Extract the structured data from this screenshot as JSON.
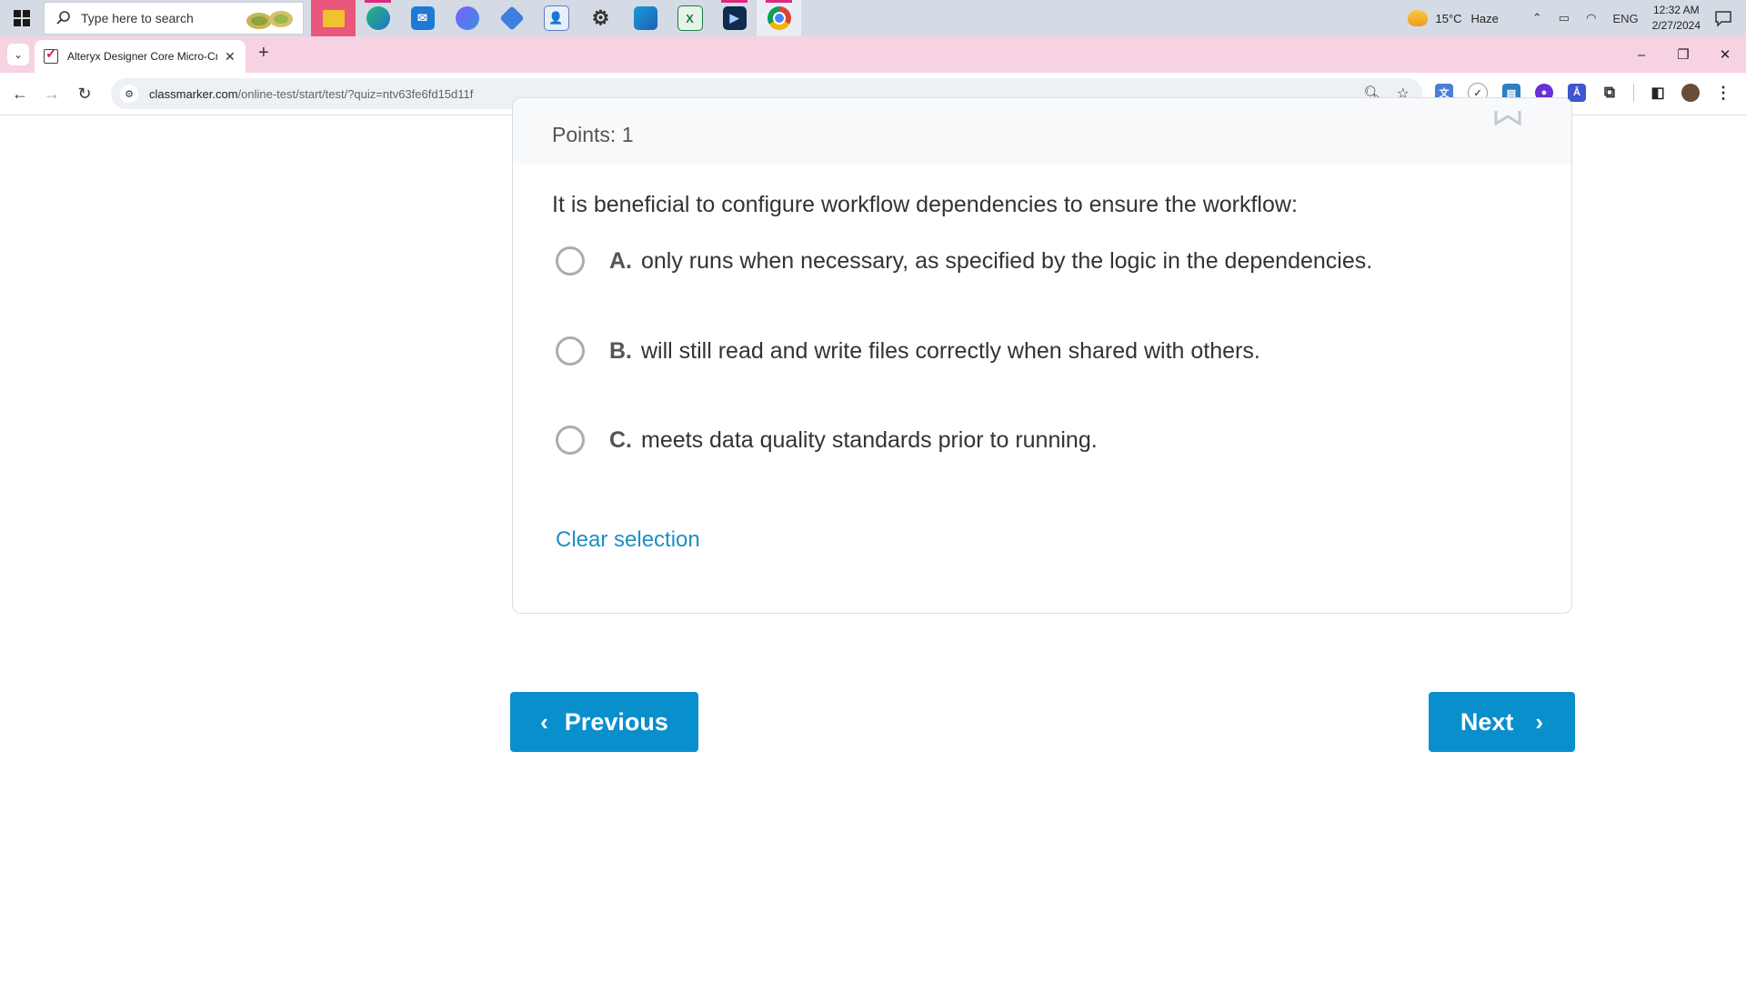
{
  "taskbar": {
    "search_placeholder": "Type here to search",
    "apps": [
      "file-explorer-icon",
      "edge-icon",
      "mail-icon",
      "teams-icon",
      "gem-icon",
      "contacts-icon",
      "settings-icon",
      "photos-icon",
      "excel-icon",
      "terminal-icon",
      "chrome-icon"
    ],
    "weather_temp": "15°C",
    "weather_desc": "Haze",
    "language": "ENG",
    "time": "12:32 AM",
    "date": "2/27/2024"
  },
  "browser": {
    "tab_title": "Alteryx Designer Core Micro-Cr",
    "url_domain": "classmarker.com",
    "url_path": "/online-test/start/test/?quiz=ntv63fe6fd15d11f"
  },
  "quiz": {
    "points_label": "Points: 1",
    "question": "It is beneficial to configure workflow dependencies to ensure the workflow:",
    "options": [
      {
        "letter": "A.",
        "text": "only runs when necessary, as specified by the logic in the dependencies."
      },
      {
        "letter": "B.",
        "text": "will still read and write files correctly when shared with others."
      },
      {
        "letter": "C.",
        "text": "meets data quality standards prior to running."
      }
    ],
    "clear_label": "Clear selection",
    "previous_label": "Previous",
    "next_label": "Next"
  },
  "colors": {
    "accent": "#0a8fcd",
    "link": "#1e8ec7",
    "tabstrip": "#f6d2e3"
  }
}
